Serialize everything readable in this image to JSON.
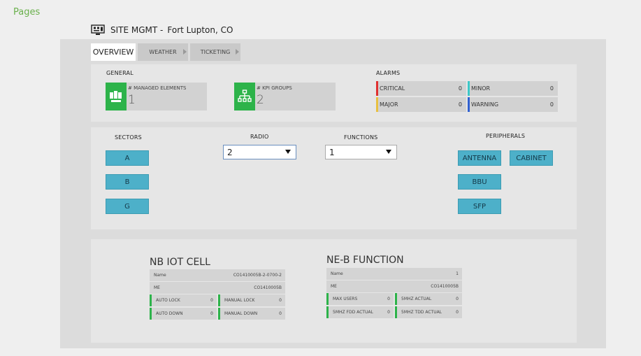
{
  "nav": {
    "pages_label": "Pages"
  },
  "site": {
    "title": "SITE MGMT -",
    "location": "Fort Lupton, CO"
  },
  "tabs": [
    {
      "label": "OVERVIEW"
    },
    {
      "label": "WEATHER"
    },
    {
      "label": "TICKETING"
    }
  ],
  "general": {
    "heading": "GENERAL",
    "managed_label": "# MANAGED ELEMENTS",
    "managed_value": "1",
    "kpi_label": "# KPI GROUPS",
    "kpi_value": "2"
  },
  "alarms": {
    "heading": "ALARMS",
    "items": [
      {
        "label": "CRITICAL",
        "value": "0",
        "color": "#e03030"
      },
      {
        "label": "MINOR",
        "value": "0",
        "color": "#3cc8c8"
      },
      {
        "label": "MAJOR",
        "value": "0",
        "color": "#e8c040"
      },
      {
        "label": "WARNING",
        "value": "0",
        "color": "#3060d0"
      }
    ]
  },
  "sectors": {
    "heading": "SECTORS",
    "items": [
      "A",
      "B",
      "G"
    ]
  },
  "radio": {
    "heading": "RADIO",
    "selected": "2"
  },
  "functions": {
    "heading": "FUNCTIONS",
    "selected": "1"
  },
  "peripherals": {
    "heading": "PERIPHERALS",
    "items": [
      "ANTENNA",
      "CABINET",
      "BBU",
      "SFP"
    ]
  },
  "nb_iot": {
    "title": "NB IOT CELL",
    "name_label": "Name",
    "name_value": "CO1410005B-2-0700-2",
    "me_label": "ME",
    "me_value": "CO1410005B",
    "auto_lock_label": "AUTO LOCK",
    "auto_lock_value": "0",
    "manual_lock_label": "MANUAL LOCK",
    "manual_lock_value": "0",
    "auto_down_label": "AUTO DOWN",
    "auto_down_value": "0",
    "manual_down_label": "MANUAL DOWN",
    "manual_down_value": "0"
  },
  "neb": {
    "title": "NE-B FUNCTION",
    "name_label": "Name",
    "name_value": "1",
    "me_label": "ME",
    "me_value": "CO1410005B",
    "max_users_label": "MAX USERS",
    "max_users_value": "0",
    "mhz_actual_label": "5MHZ ACTUAL",
    "mhz_actual_value": "0",
    "fdd_label": "5MHZ FDD ACTUAL",
    "fdd_value": "0",
    "tdd_label": "5MHZ TDD ACTUAL",
    "tdd_value": "0"
  },
  "colors": {
    "green": "#2db34a",
    "button": "#4db0c9"
  }
}
